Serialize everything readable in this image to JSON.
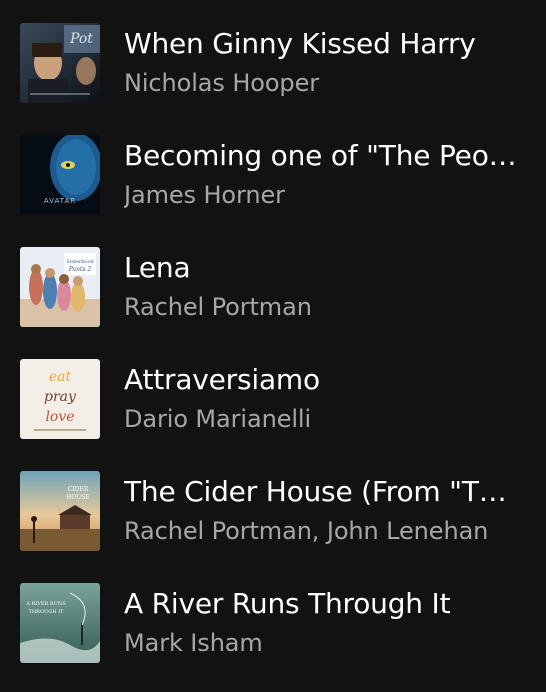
{
  "tracks": [
    {
      "title": "When Ginny Kissed Harry",
      "artist": "Nicholas Hooper",
      "cover_icon": "harry-potter-album-cover"
    },
    {
      "title": "Becoming one of \"The People\"",
      "artist": "James Horner",
      "cover_icon": "avatar-album-cover",
      "cover_text": "AVATAR"
    },
    {
      "title": "Lena",
      "artist": "Rachel Portman",
      "cover_icon": "sisterhood-traveling-pants-2-album-cover"
    },
    {
      "title": "Attraversiamo",
      "artist": "Dario Marianelli",
      "cover_icon": "eat-pray-love-album-cover",
      "cover_text": [
        "eat",
        "pray",
        "love"
      ]
    },
    {
      "title": "The Cider House (From \"The Cider House Rules\")",
      "artist": "Rachel Portman, John Lenehan",
      "cover_icon": "cider-house-rules-album-cover"
    },
    {
      "title": "A River Runs Through It",
      "artist": "Mark Isham",
      "cover_icon": "river-runs-through-it-album-cover"
    }
  ],
  "colors": {
    "background": "#121212",
    "title": "#ffffff",
    "artist": "#a7a7a7"
  }
}
